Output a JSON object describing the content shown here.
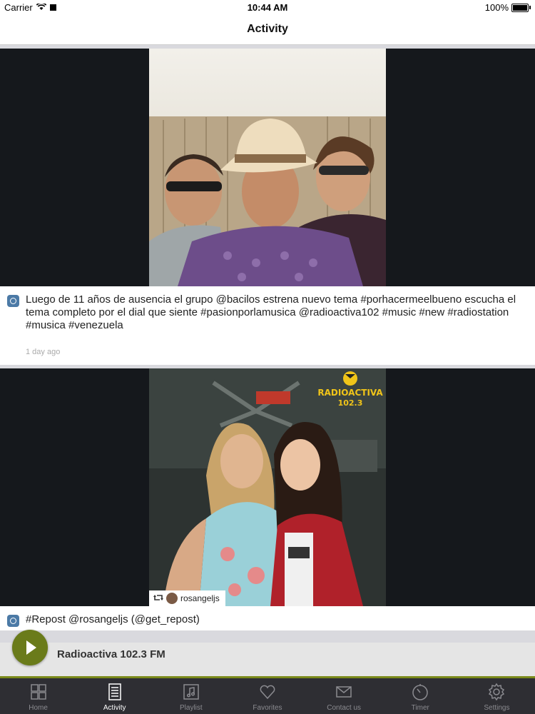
{
  "status_bar": {
    "carrier": "Carrier",
    "time": "10:44 AM",
    "battery": "100%"
  },
  "nav": {
    "title": "Activity"
  },
  "posts": [
    {
      "caption": "Luego de 11 años de ausencia el grupo @bacilos estrena nuevo tema #porhacermeelbueno escucha el tema completo por el dial que siente #pasionporlamusica @radioactiva102 #music #new #radiostation #musica #venezuela",
      "time_ago": "1 day ago"
    },
    {
      "caption": "#Repost @rosangeljs (@get_repost)",
      "repost_user": "rosangeljs",
      "logo_text": "RADIOACTIVA",
      "logo_freq": "102.3"
    }
  ],
  "player": {
    "station": "Radioactiva 102.3 FM"
  },
  "tabs": [
    {
      "label": "Home",
      "icon": "grid-icon"
    },
    {
      "label": "Activity",
      "icon": "document-icon"
    },
    {
      "label": "Playlist",
      "icon": "music-icon"
    },
    {
      "label": "Favorites",
      "icon": "heart-icon"
    },
    {
      "label": "Contact us",
      "icon": "envelope-icon"
    },
    {
      "label": "Timer",
      "icon": "timer-icon"
    },
    {
      "label": "Settings",
      "icon": "gear-icon"
    }
  ],
  "colors": {
    "accent": "#6a7b1a",
    "tabbar": "#2e2e33",
    "ig": "#4c7aa6"
  }
}
